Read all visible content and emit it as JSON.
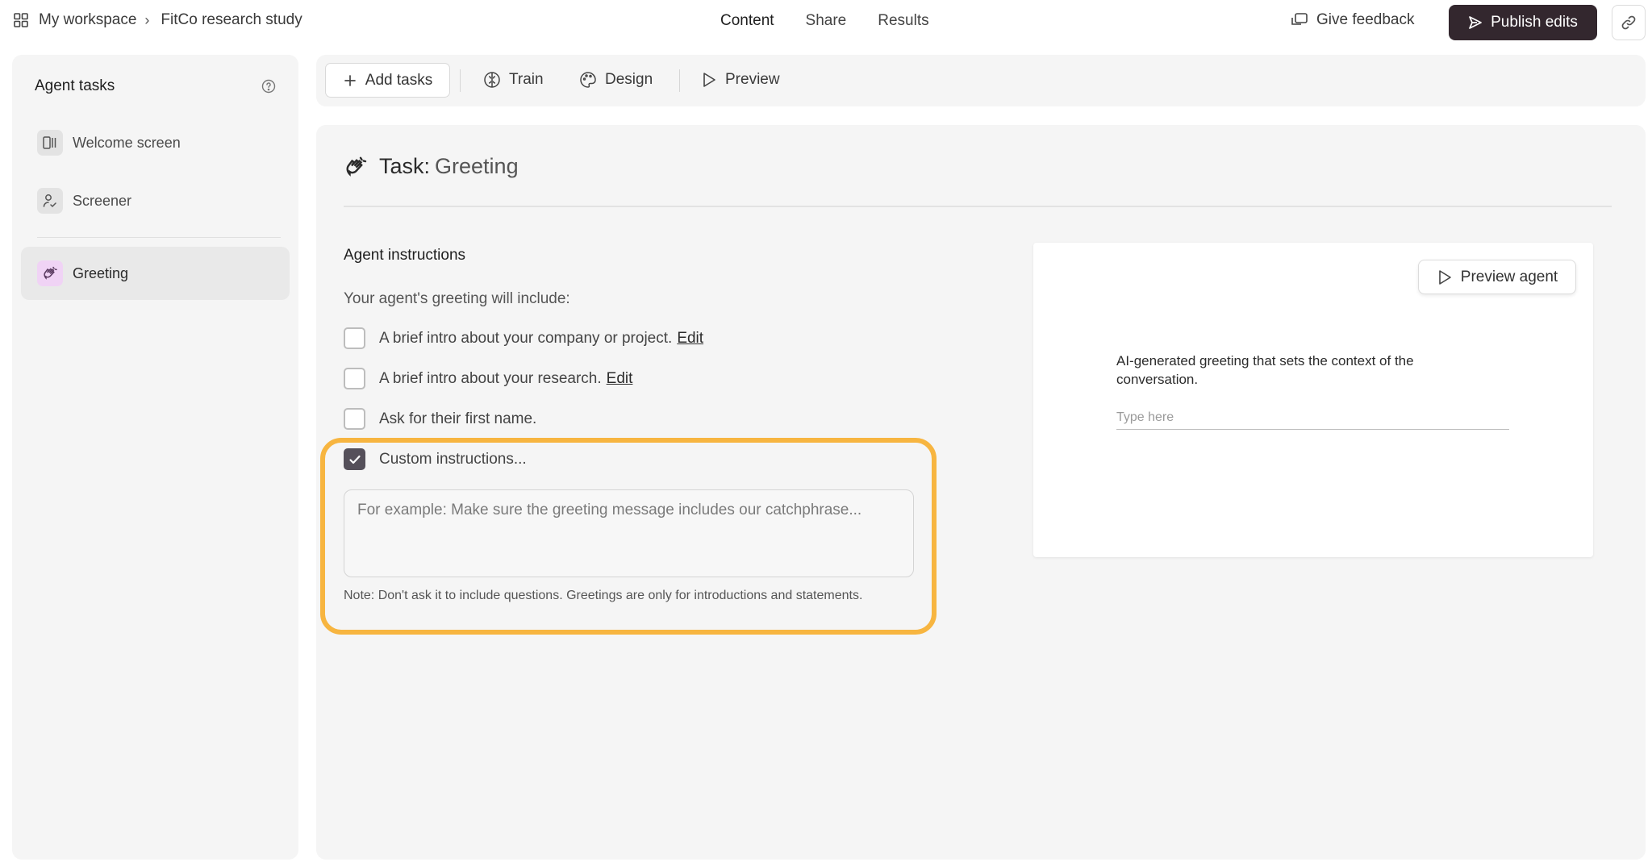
{
  "breadcrumb": {
    "workspace": "My workspace",
    "separator": "›",
    "project": "FitCo research study"
  },
  "topnav": {
    "content": "Content",
    "share": "Share",
    "results": "Results"
  },
  "header_actions": {
    "feedback": "Give feedback",
    "publish": "Publish edits"
  },
  "sidebar": {
    "title": "Agent tasks",
    "items": [
      {
        "label": "Welcome screen",
        "icon": "welcome-screen-icon"
      },
      {
        "label": "Screener",
        "icon": "screener-icon"
      },
      {
        "label": "Greeting",
        "icon": "greeting-icon",
        "selected": true
      }
    ]
  },
  "toolbar": {
    "add_tasks": "Add tasks",
    "train": "Train",
    "design": "Design",
    "preview": "Preview"
  },
  "task": {
    "prefix": "Task:",
    "name": "Greeting"
  },
  "instructions": {
    "section_label": "Agent instructions",
    "intro": "Your agent's greeting will include:",
    "options": [
      {
        "text": "A brief intro about your company or project.",
        "edit": "Edit",
        "checked": false
      },
      {
        "text": "A brief intro about your research.",
        "edit": "Edit",
        "checked": false
      },
      {
        "text": "Ask for their first name.",
        "checked": false
      },
      {
        "text": "Custom instructions...",
        "checked": true
      }
    ],
    "custom_placeholder": "For example: Make sure the greeting message includes our catchphrase...",
    "note": "Note: Don't ask it to include questions. Greetings are only for introductions and statements."
  },
  "preview": {
    "button": "Preview agent",
    "description": "AI-generated greeting that sets the context of the conversation.",
    "input_placeholder": "Type here"
  },
  "colors": {
    "publish_bg": "#33272e",
    "highlight": "#f7b540",
    "greeting_icon_bg": "#f0d3f5"
  }
}
